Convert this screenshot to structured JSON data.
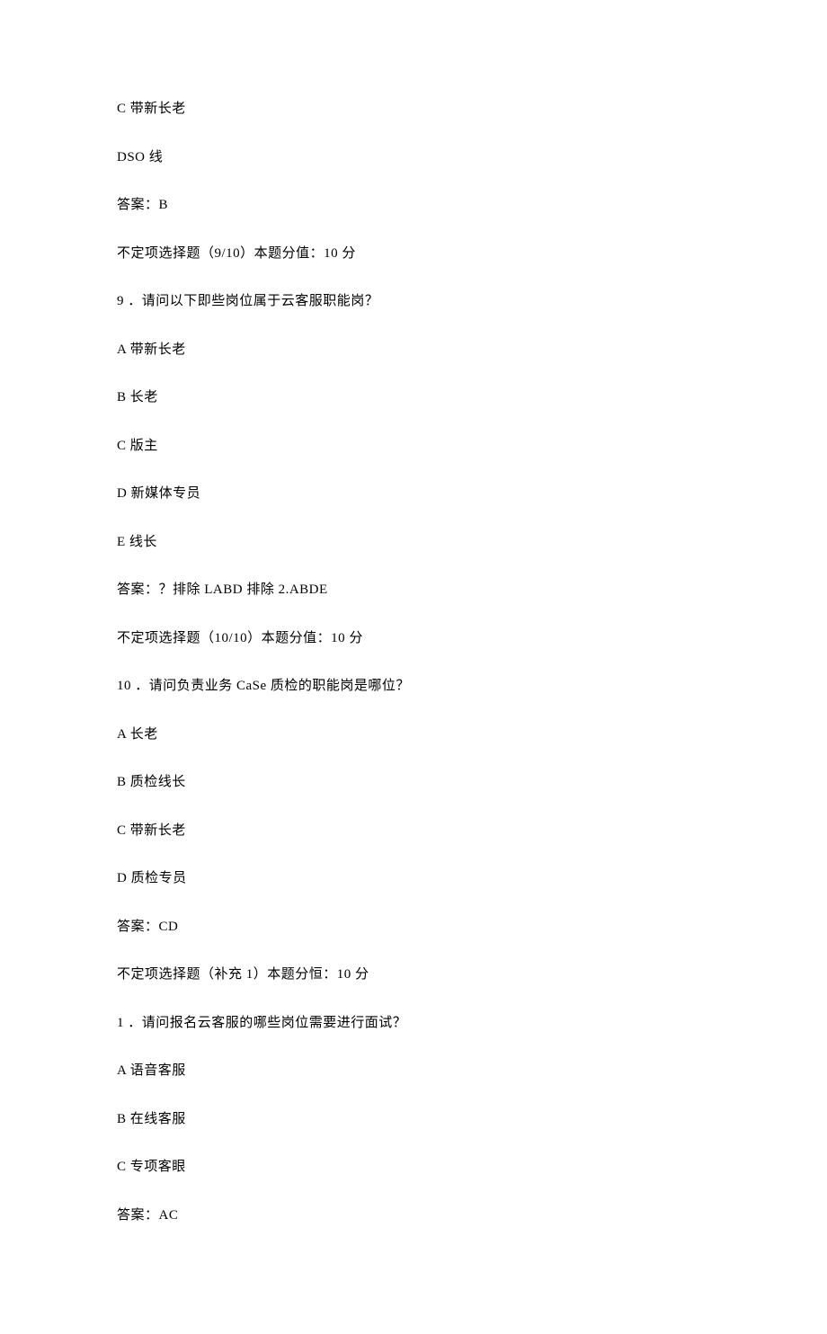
{
  "lines": [
    "C 带新长老",
    "DSO 线",
    "答案：B",
    "不定项选择题（9/10）本题分值：10 分",
    "9 ．请问以下即些岗位属于云客服职能岗？",
    "A 带新长老",
    "B 长老",
    "C 版主",
    "D 新媒体专员",
    "E 线长",
    "答案：？排除 LABD 排除 2.ABDE",
    "不定项选择题（10/10）本题分值：10 分",
    "10 ．请问负责业务 CaSe 质检的职能岗是哪位？",
    "A 长老",
    "B 质检线长",
    "C 带新长老",
    "D 质检专员",
    "答案：CD",
    "不定项选择题（补充 1）本题分恒：10 分",
    "1 ．请问报名云客服的哪些岗位需要进行面试？",
    "A 语音客服",
    "B 在线客服",
    "C 专项客眼",
    "答案：AC"
  ]
}
